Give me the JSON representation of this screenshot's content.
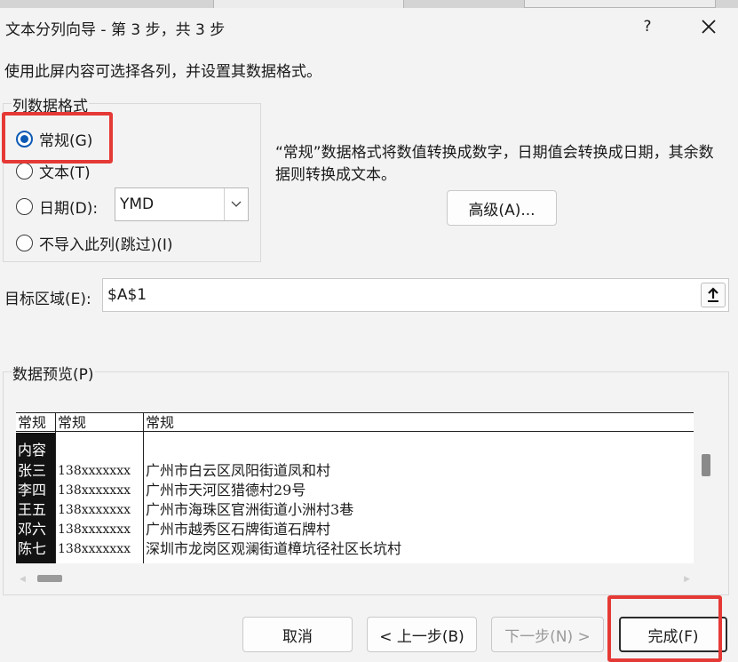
{
  "window": {
    "title": "文本分列向导 - 第 3 步，共 3 步",
    "help_label": "?"
  },
  "instruction": "使用此屏内容可选择各列，并设置其数据格式。",
  "column_format": {
    "group_label": "列数据格式",
    "options": [
      {
        "label": "常规(G)",
        "selected": true
      },
      {
        "label": "文本(T)",
        "selected": false
      },
      {
        "label": "日期(D):",
        "selected": false
      },
      {
        "label": "不导入此列(跳过)(I)",
        "selected": false
      }
    ],
    "date_format_value": "YMD",
    "description": "“常规”数据格式将数值转换成数字，日期值会转换成日期，其余数据则转换成文本。",
    "advanced_button": "高级(A)..."
  },
  "destination": {
    "label": "目标区域(E):",
    "value": "$A$1"
  },
  "preview": {
    "label": "数据预览(P)",
    "headers": [
      "常规",
      "常规",
      "常规"
    ],
    "rows": [
      [
        "内容",
        "",
        ""
      ],
      [
        "张三",
        "138xxxxxxx",
        "广州市白云区凤阳街道凤和村"
      ],
      [
        "李四",
        "138xxxxxxx",
        "广州市天河区猎德村29号"
      ],
      [
        "王五",
        "138xxxxxxx",
        "广州市海珠区官洲街道小洲村3巷"
      ],
      [
        "邓六",
        "138xxxxxxx",
        "广州市越秀区石牌街道石牌村"
      ],
      [
        "陈七",
        "138xxxxxxx",
        "深圳市龙岗区观澜街道樟坑径社区长坑村"
      ]
    ]
  },
  "buttons": {
    "cancel": "取消",
    "back": "< 上一步(B)",
    "next": "下一步(N) >",
    "finish": "完成(F)"
  },
  "colors": {
    "highlight": "#e53935",
    "radio_selected": "#0d5ab5"
  }
}
